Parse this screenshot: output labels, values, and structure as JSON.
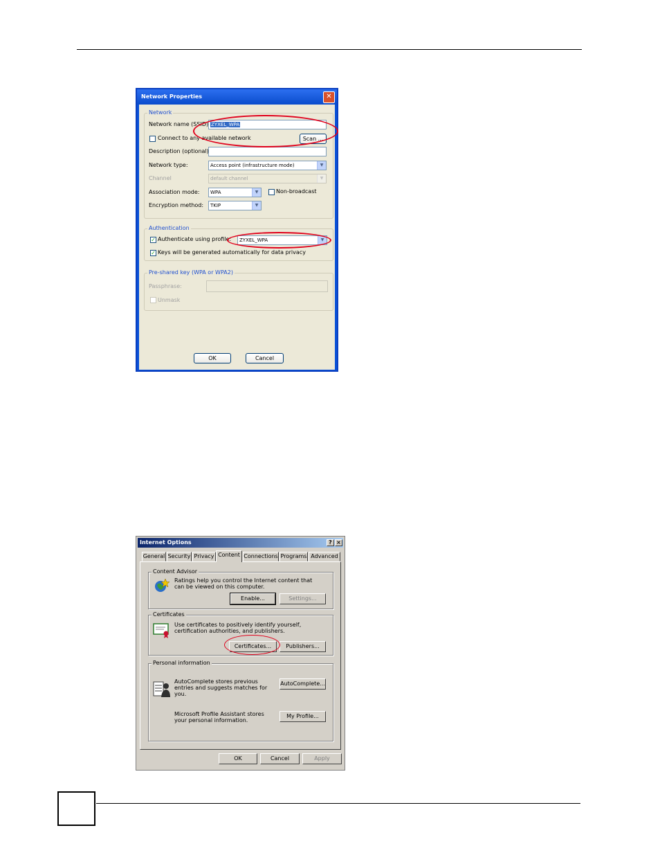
{
  "network_properties": {
    "title": "Network Properties",
    "close_glyph": "✕",
    "network_group": "Network",
    "ssid_label": "Network name (SSID):",
    "ssid_value": "ZYXEL_WPA",
    "connect_any_label": "Connect to any available network",
    "scan_button": "Scan ...",
    "description_label": "Description (optional):",
    "network_type_label": "Network type:",
    "network_type_value": "Access point (infrastructure mode)",
    "channel_label": "Channel",
    "channel_value": "default channel",
    "association_label": "Association mode:",
    "association_value": "WPA",
    "non_broadcast_label": "Non-broadcast",
    "encryption_label": "Encryption method:",
    "encryption_value": "TKIP",
    "auth_group": "Authentication",
    "auth_profile_label": "Authenticate using profile:",
    "auth_profile_value": "ZYXEL_WPA",
    "keys_auto_label": "Keys will be generated automatically for data privacy",
    "psk_group": "Pre-shared key (WPA or WPA2)",
    "passphrase_label": "Passphrase:",
    "unmask_label": "Unmask",
    "ok_button": "OK",
    "cancel_button": "Cancel"
  },
  "internet_options": {
    "title": "Internet Options",
    "help_glyph": "?",
    "close_glyph": "×",
    "tabs": [
      "General",
      "Security",
      "Privacy",
      "Content",
      "Connections",
      "Programs",
      "Advanced"
    ],
    "active_tab": "Content",
    "content_advisor_group": "Content Advisor",
    "content_advisor_text": "Ratings help you control the Internet content that can be viewed on this computer.",
    "enable_button": "Enable...",
    "settings_button": "Settings...",
    "certificates_group": "Certificates",
    "certificates_text": "Use certificates to positively identify yourself, certification authorities, and publishers.",
    "certificates_button": "Certificates...",
    "publishers_button": "Publishers...",
    "personal_group": "Personal information",
    "autocomplete_text": "AutoComplete stores previous entries and suggests matches for you.",
    "autocomplete_button": "AutoComplete...",
    "profile_text": "Microsoft Profile Assistant stores your personal information.",
    "my_profile_button": "My Profile...",
    "ok_button": "OK",
    "cancel_button": "Cancel",
    "apply_button": "Apply"
  },
  "colors": {
    "highlight": "#e0001b",
    "xp_title": "#0a52d8",
    "classic_title": "#0a246a"
  }
}
